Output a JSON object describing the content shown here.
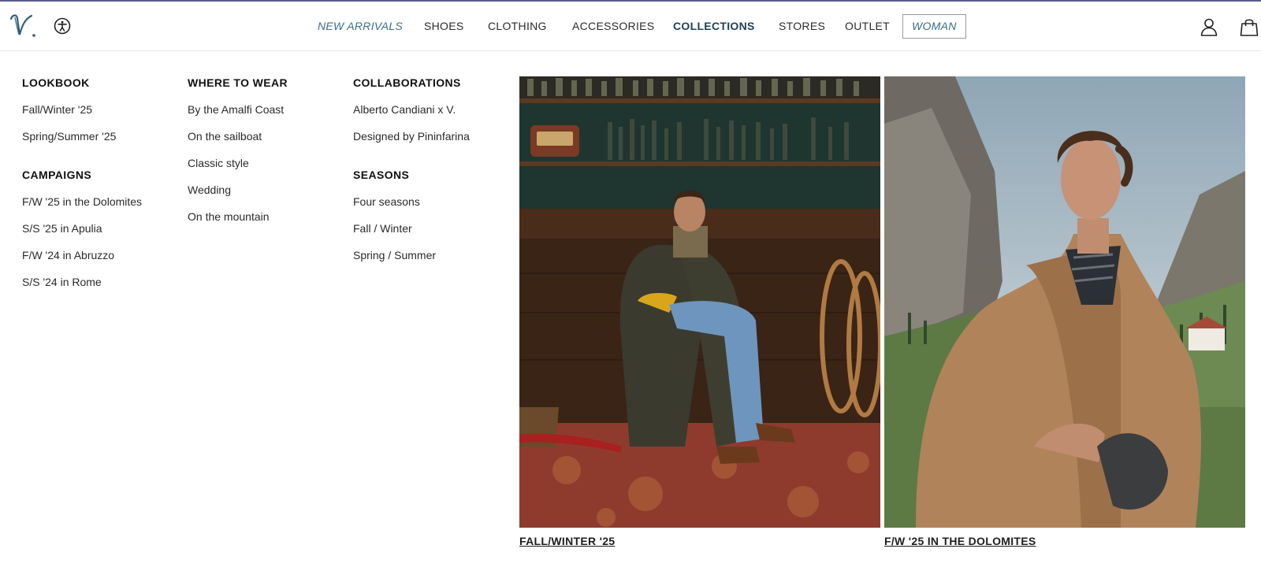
{
  "brand": {
    "logo_text": "V."
  },
  "nav": {
    "items": [
      {
        "label": "NEW ARRIVALS"
      },
      {
        "label": "SHOES"
      },
      {
        "label": "CLOTHING"
      },
      {
        "label": "ACCESSORIES"
      },
      {
        "label": "COLLECTIONS"
      },
      {
        "label": "STORES"
      },
      {
        "label": "OUTLET"
      },
      {
        "label": "WOMAN"
      }
    ],
    "active": "COLLECTIONS"
  },
  "icons": {
    "accessibility": "accessibility-icon",
    "account": "user-icon",
    "cart": "shopping-bag-icon"
  },
  "menu": {
    "columns": [
      {
        "sections": [
          {
            "heading": "LOOKBOOK",
            "links": [
              "Fall/Winter '25",
              "Spring/Summer '25"
            ]
          },
          {
            "heading": "CAMPAIGNS",
            "links": [
              "F/W '25 in the Dolomites",
              "S/S '25 in Apulia",
              "F/W '24 in Abruzzo",
              "S/S '24 in Rome"
            ]
          }
        ]
      },
      {
        "sections": [
          {
            "heading": "WHERE TO WEAR",
            "links": [
              "By the Amalfi Coast",
              "On the sailboat",
              "Classic style",
              "Wedding",
              "On the mountain"
            ]
          }
        ]
      },
      {
        "sections": [
          {
            "heading": "COLLABORATIONS",
            "links": [
              "Alberto Candiani x V.",
              "Designed by Pininfarina"
            ]
          },
          {
            "heading": "SEASONS",
            "links": [
              "Four seasons",
              "Fall / Winter",
              "Spring / Summer"
            ]
          }
        ]
      }
    ]
  },
  "promos": [
    {
      "caption": "FALL/WINTER '25"
    },
    {
      "caption": "F/W '25 IN THE DOLOMITES"
    }
  ],
  "colors": {
    "accent_bar": "#5b5a8a",
    "nav_italic": "#3c6e85",
    "nav_active": "#1f3f57"
  }
}
